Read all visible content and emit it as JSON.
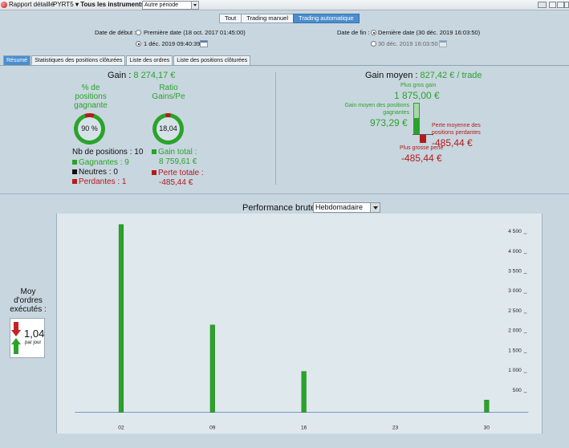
{
  "toolbar": {
    "report_title": "Rapport détaillé",
    "instrument": "PYRT5",
    "instruments_filter": "Tous les instruments",
    "period": "Autre période"
  },
  "modes": {
    "all": "Tout",
    "manual": "Trading manuel",
    "automatic": "Trading automatique",
    "active": "automatic"
  },
  "dates": {
    "start_label": "Date de début :",
    "start_first": "Première date (18 oct. 2017 01:45:00)",
    "start_custom": "1 déc. 2019 09:40:39",
    "end_label": "Date de fin :",
    "end_last": "Dernière date (30 déc. 2019 16:03:50)",
    "end_custom": "30 déc. 2019 16:03:50"
  },
  "tabs": [
    "Résumé",
    "Statistiques des positions clôturées",
    "Liste des ordres",
    "Liste des positions clôturées"
  ],
  "summary": {
    "gain_label": "Gain :",
    "gain_value": "8 274,17 €",
    "pct_winning_label": [
      "% de",
      "positions",
      "gagnante"
    ],
    "pct_winning_value": "90 %",
    "pct_winning_fraction": 0.9,
    "ratio_label": [
      "Ratio",
      "Gains/Pe"
    ],
    "ratio_value": "18,04",
    "nb_positions": "Nb de positions : 10",
    "winning": "Gagnantes : 9",
    "neutral": "Neutres : 0",
    "losing": "Perdantes : 1",
    "total_gain_label": "Gain total :",
    "total_gain_value": "8 759,61 €",
    "total_loss_label": "Perte totale :",
    "total_loss_value": "-485,44 €"
  },
  "average": {
    "label": "Gain moyen :",
    "value": "827,42 € / trade",
    "biggest_gain_label": "Plus gros gain",
    "biggest_gain_value": "1 875,00 €",
    "avg_win_label": [
      "Gain moyen des positions",
      "gagnantes"
    ],
    "avg_win_value": "973,29 €",
    "avg_loss_label": [
      "Perte moyenne des",
      "positions perdantes"
    ],
    "avg_loss_value": "-485,44 €",
    "biggest_loss_label": "Plus grosse perte",
    "biggest_loss_value": "-485,44 €"
  },
  "orders": {
    "label": [
      "Moy",
      "d'ordres",
      "exécutés :"
    ],
    "value": "1,04",
    "unit": "par jour"
  },
  "chart_header": {
    "title": "Performance brute",
    "frequency": "Hebdomadaire"
  },
  "colors": {
    "accent": "#4a8ed0",
    "gain": "#2aa32a",
    "loss": "#b31b1b",
    "background": "#c8d6df"
  },
  "chart_data": {
    "type": "bar",
    "categories": [
      "02",
      "09",
      "16",
      "23",
      "30"
    ],
    "values": [
      4730,
      2200,
      1030,
      0,
      310
    ],
    "ylim": [
      0,
      4700
    ],
    "yticks": [
      500,
      1000,
      1500,
      2000,
      2500,
      3000,
      3500,
      4000,
      4500
    ],
    "ytick_labels": [
      "500",
      "1 000",
      "1 500",
      "2 000",
      "2 500",
      "3 000",
      "3 500",
      "4 000",
      "4 500"
    ],
    "color": "#2aa32a"
  }
}
